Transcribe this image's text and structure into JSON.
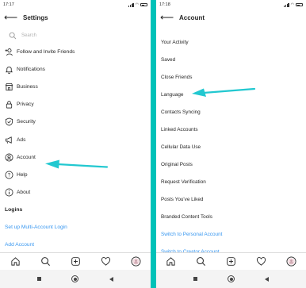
{
  "left": {
    "status_time": "17:17",
    "title": "Settings",
    "search_placeholder": "Search",
    "items": [
      {
        "label": "Follow and Invite Friends",
        "icon": "add-person-icon"
      },
      {
        "label": "Notifications",
        "icon": "bell-icon"
      },
      {
        "label": "Business",
        "icon": "shop-icon"
      },
      {
        "label": "Privacy",
        "icon": "lock-icon"
      },
      {
        "label": "Security",
        "icon": "shield-icon"
      },
      {
        "label": "Ads",
        "icon": "megaphone-icon"
      },
      {
        "label": "Account",
        "icon": "account-icon"
      },
      {
        "label": "Help",
        "icon": "help-icon"
      },
      {
        "label": "About",
        "icon": "info-icon"
      }
    ],
    "section_logins": "Logins",
    "link_multi_login": "Set up Multi-Account Login",
    "link_add_account": "Add Account"
  },
  "right": {
    "status_time": "17:18",
    "title": "Account",
    "items": [
      "Your Activity",
      "Saved",
      "Close Friends",
      "Language",
      "Contacts Syncing",
      "Linked Accounts",
      "Cellular Data Use",
      "Original Posts",
      "Request Verification",
      "Posts You've Liked",
      "Branded Content Tools"
    ],
    "link_personal": "Switch to Personal Account",
    "link_creator": "Switch to Creator Account"
  },
  "colors": {
    "accent_link": "#3897f0",
    "arrow": "#22c8d0",
    "background": "#00c2b8"
  }
}
